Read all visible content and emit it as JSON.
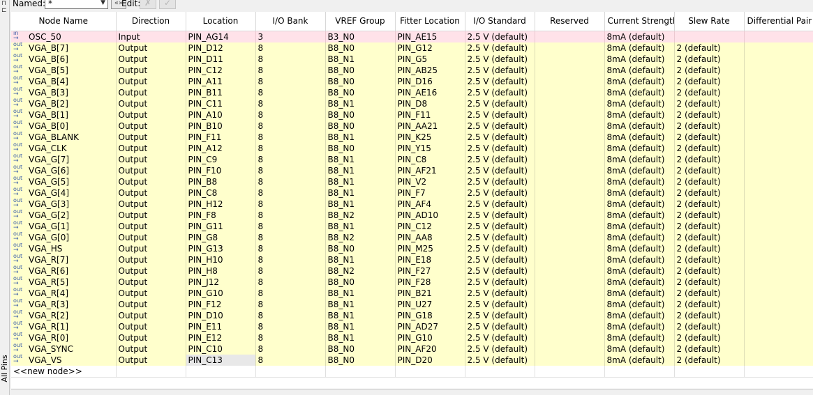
{
  "side": {
    "title": "All Pins",
    "pin_glyph_1": "⊓",
    "pin_glyph_2": "⊏"
  },
  "toolbar": {
    "named_label": "Named:",
    "named_value": "*",
    "reveal_label": "«»",
    "edit_label": "Edit:",
    "cancel_glyph": "✗",
    "accept_glyph": "✓"
  },
  "columns": [
    "Node Name",
    "Direction",
    "Location",
    "I/O Bank",
    "VREF Group",
    "Fitter Location",
    "I/O Standard",
    "Reserved",
    "Current Strength",
    "Slew Rate",
    "Differential Pair"
  ],
  "icons": {
    "in": "in",
    "out": "out"
  },
  "rows": [
    {
      "dir_icon": "in",
      "name": "OSC_50",
      "direction": "Input",
      "location": "PIN_AG14",
      "bank": "3",
      "vref": "B3_N0",
      "fitter": "PIN_AE15",
      "standard": "2.5 V (default)",
      "reserved": "",
      "current": "8mA (default)",
      "slew": "",
      "diff": ""
    },
    {
      "dir_icon": "out",
      "name": "VGA_B[7]",
      "direction": "Output",
      "location": "PIN_D12",
      "bank": "8",
      "vref": "B8_N0",
      "fitter": "PIN_G12",
      "standard": "2.5 V (default)",
      "reserved": "",
      "current": "8mA (default)",
      "slew": "2 (default)",
      "diff": ""
    },
    {
      "dir_icon": "out",
      "name": "VGA_B[6]",
      "direction": "Output",
      "location": "PIN_D11",
      "bank": "8",
      "vref": "B8_N1",
      "fitter": "PIN_G5",
      "standard": "2.5 V (default)",
      "reserved": "",
      "current": "8mA (default)",
      "slew": "2 (default)",
      "diff": ""
    },
    {
      "dir_icon": "out",
      "name": "VGA_B[5]",
      "direction": "Output",
      "location": "PIN_C12",
      "bank": "8",
      "vref": "B8_N0",
      "fitter": "PIN_AB25",
      "standard": "2.5 V (default)",
      "reserved": "",
      "current": "8mA (default)",
      "slew": "2 (default)",
      "diff": ""
    },
    {
      "dir_icon": "out",
      "name": "VGA_B[4]",
      "direction": "Output",
      "location": "PIN_A11",
      "bank": "8",
      "vref": "B8_N0",
      "fitter": "PIN_D16",
      "standard": "2.5 V (default)",
      "reserved": "",
      "current": "8mA (default)",
      "slew": "2 (default)",
      "diff": ""
    },
    {
      "dir_icon": "out",
      "name": "VGA_B[3]",
      "direction": "Output",
      "location": "PIN_B11",
      "bank": "8",
      "vref": "B8_N0",
      "fitter": "PIN_AE16",
      "standard": "2.5 V (default)",
      "reserved": "",
      "current": "8mA (default)",
      "slew": "2 (default)",
      "diff": ""
    },
    {
      "dir_icon": "out",
      "name": "VGA_B[2]",
      "direction": "Output",
      "location": "PIN_C11",
      "bank": "8",
      "vref": "B8_N1",
      "fitter": "PIN_D8",
      "standard": "2.5 V (default)",
      "reserved": "",
      "current": "8mA (default)",
      "slew": "2 (default)",
      "diff": ""
    },
    {
      "dir_icon": "out",
      "name": "VGA_B[1]",
      "direction": "Output",
      "location": "PIN_A10",
      "bank": "8",
      "vref": "B8_N0",
      "fitter": "PIN_F11",
      "standard": "2.5 V (default)",
      "reserved": "",
      "current": "8mA (default)",
      "slew": "2 (default)",
      "diff": ""
    },
    {
      "dir_icon": "out",
      "name": "VGA_B[0]",
      "direction": "Output",
      "location": "PIN_B10",
      "bank": "8",
      "vref": "B8_N0",
      "fitter": "PIN_AA21",
      "standard": "2.5 V (default)",
      "reserved": "",
      "current": "8mA (default)",
      "slew": "2 (default)",
      "diff": ""
    },
    {
      "dir_icon": "out",
      "name": "VGA_BLANK",
      "direction": "Output",
      "location": "PIN_F11",
      "bank": "8",
      "vref": "B8_N1",
      "fitter": "PIN_K25",
      "standard": "2.5 V (default)",
      "reserved": "",
      "current": "8mA (default)",
      "slew": "2 (default)",
      "diff": ""
    },
    {
      "dir_icon": "out",
      "name": "VGA_CLK",
      "direction": "Output",
      "location": "PIN_A12",
      "bank": "8",
      "vref": "B8_N0",
      "fitter": "PIN_Y15",
      "standard": "2.5 V (default)",
      "reserved": "",
      "current": "8mA (default)",
      "slew": "2 (default)",
      "diff": ""
    },
    {
      "dir_icon": "out",
      "name": "VGA_G[7]",
      "direction": "Output",
      "location": "PIN_C9",
      "bank": "8",
      "vref": "B8_N1",
      "fitter": "PIN_C8",
      "standard": "2.5 V (default)",
      "reserved": "",
      "current": "8mA (default)",
      "slew": "2 (default)",
      "diff": ""
    },
    {
      "dir_icon": "out",
      "name": "VGA_G[6]",
      "direction": "Output",
      "location": "PIN_F10",
      "bank": "8",
      "vref": "B8_N1",
      "fitter": "PIN_AF21",
      "standard": "2.5 V (default)",
      "reserved": "",
      "current": "8mA (default)",
      "slew": "2 (default)",
      "diff": ""
    },
    {
      "dir_icon": "out",
      "name": "VGA_G[5]",
      "direction": "Output",
      "location": "PIN_B8",
      "bank": "8",
      "vref": "B8_N1",
      "fitter": "PIN_V2",
      "standard": "2.5 V (default)",
      "reserved": "",
      "current": "8mA (default)",
      "slew": "2 (default)",
      "diff": ""
    },
    {
      "dir_icon": "out",
      "name": "VGA_G[4]",
      "direction": "Output",
      "location": "PIN_C8",
      "bank": "8",
      "vref": "B8_N1",
      "fitter": "PIN_F7",
      "standard": "2.5 V (default)",
      "reserved": "",
      "current": "8mA (default)",
      "slew": "2 (default)",
      "diff": ""
    },
    {
      "dir_icon": "out",
      "name": "VGA_G[3]",
      "direction": "Output",
      "location": "PIN_H12",
      "bank": "8",
      "vref": "B8_N1",
      "fitter": "PIN_AF4",
      "standard": "2.5 V (default)",
      "reserved": "",
      "current": "8mA (default)",
      "slew": "2 (default)",
      "diff": ""
    },
    {
      "dir_icon": "out",
      "name": "VGA_G[2]",
      "direction": "Output",
      "location": "PIN_F8",
      "bank": "8",
      "vref": "B8_N2",
      "fitter": "PIN_AD10",
      "standard": "2.5 V (default)",
      "reserved": "",
      "current": "8mA (default)",
      "slew": "2 (default)",
      "diff": ""
    },
    {
      "dir_icon": "out",
      "name": "VGA_G[1]",
      "direction": "Output",
      "location": "PIN_G11",
      "bank": "8",
      "vref": "B8_N1",
      "fitter": "PIN_C12",
      "standard": "2.5 V (default)",
      "reserved": "",
      "current": "8mA (default)",
      "slew": "2 (default)",
      "diff": ""
    },
    {
      "dir_icon": "out",
      "name": "VGA_G[0]",
      "direction": "Output",
      "location": "PIN_G8",
      "bank": "8",
      "vref": "B8_N2",
      "fitter": "PIN_AA8",
      "standard": "2.5 V (default)",
      "reserved": "",
      "current": "8mA (default)",
      "slew": "2 (default)",
      "diff": ""
    },
    {
      "dir_icon": "out",
      "name": "VGA_HS",
      "direction": "Output",
      "location": "PIN_G13",
      "bank": "8",
      "vref": "B8_N0",
      "fitter": "PIN_M25",
      "standard": "2.5 V (default)",
      "reserved": "",
      "current": "8mA (default)",
      "slew": "2 (default)",
      "diff": ""
    },
    {
      "dir_icon": "out",
      "name": "VGA_R[7]",
      "direction": "Output",
      "location": "PIN_H10",
      "bank": "8",
      "vref": "B8_N1",
      "fitter": "PIN_E18",
      "standard": "2.5 V (default)",
      "reserved": "",
      "current": "8mA (default)",
      "slew": "2 (default)",
      "diff": ""
    },
    {
      "dir_icon": "out",
      "name": "VGA_R[6]",
      "direction": "Output",
      "location": "PIN_H8",
      "bank": "8",
      "vref": "B8_N2",
      "fitter": "PIN_F27",
      "standard": "2.5 V (default)",
      "reserved": "",
      "current": "8mA (default)",
      "slew": "2 (default)",
      "diff": ""
    },
    {
      "dir_icon": "out",
      "name": "VGA_R[5]",
      "direction": "Output",
      "location": "PIN_J12",
      "bank": "8",
      "vref": "B8_N0",
      "fitter": "PIN_F28",
      "standard": "2.5 V (default)",
      "reserved": "",
      "current": "8mA (default)",
      "slew": "2 (default)",
      "diff": ""
    },
    {
      "dir_icon": "out",
      "name": "VGA_R[4]",
      "direction": "Output",
      "location": "PIN_G10",
      "bank": "8",
      "vref": "B8_N1",
      "fitter": "PIN_B21",
      "standard": "2.5 V (default)",
      "reserved": "",
      "current": "8mA (default)",
      "slew": "2 (default)",
      "diff": ""
    },
    {
      "dir_icon": "out",
      "name": "VGA_R[3]",
      "direction": "Output",
      "location": "PIN_F12",
      "bank": "8",
      "vref": "B8_N1",
      "fitter": "PIN_U27",
      "standard": "2.5 V (default)",
      "reserved": "",
      "current": "8mA (default)",
      "slew": "2 (default)",
      "diff": ""
    },
    {
      "dir_icon": "out",
      "name": "VGA_R[2]",
      "direction": "Output",
      "location": "PIN_D10",
      "bank": "8",
      "vref": "B8_N1",
      "fitter": "PIN_G18",
      "standard": "2.5 V (default)",
      "reserved": "",
      "current": "8mA (default)",
      "slew": "2 (default)",
      "diff": ""
    },
    {
      "dir_icon": "out",
      "name": "VGA_R[1]",
      "direction": "Output",
      "location": "PIN_E11",
      "bank": "8",
      "vref": "B8_N1",
      "fitter": "PIN_AD27",
      "standard": "2.5 V (default)",
      "reserved": "",
      "current": "8mA (default)",
      "slew": "2 (default)",
      "diff": ""
    },
    {
      "dir_icon": "out",
      "name": "VGA_R[0]",
      "direction": "Output",
      "location": "PIN_E12",
      "bank": "8",
      "vref": "B8_N1",
      "fitter": "PIN_G10",
      "standard": "2.5 V (default)",
      "reserved": "",
      "current": "8mA (default)",
      "slew": "2 (default)",
      "diff": ""
    },
    {
      "dir_icon": "out",
      "name": "VGA_SYNC",
      "direction": "Output",
      "location": "PIN_C10",
      "bank": "8",
      "vref": "B8_N0",
      "fitter": "PIN_AF20",
      "standard": "2.5 V (default)",
      "reserved": "",
      "current": "8mA (default)",
      "slew": "2 (default)",
      "diff": ""
    },
    {
      "dir_icon": "out",
      "name": "VGA_VS",
      "direction": "Output",
      "location": "PIN_C13",
      "bank": "8",
      "vref": "B8_N0",
      "fitter": "PIN_D20",
      "standard": "2.5 V (default)",
      "reserved": "",
      "current": "8mA (default)",
      "slew": "2 (default)",
      "diff": "",
      "location_selected": true
    }
  ],
  "new_node_label": "<<new node>>",
  "colors": {
    "input_row": "#ffe2e9",
    "output_row": "#ffffcc",
    "selected_cell": "#e8e8e8",
    "header_bg": "#ffffff"
  }
}
